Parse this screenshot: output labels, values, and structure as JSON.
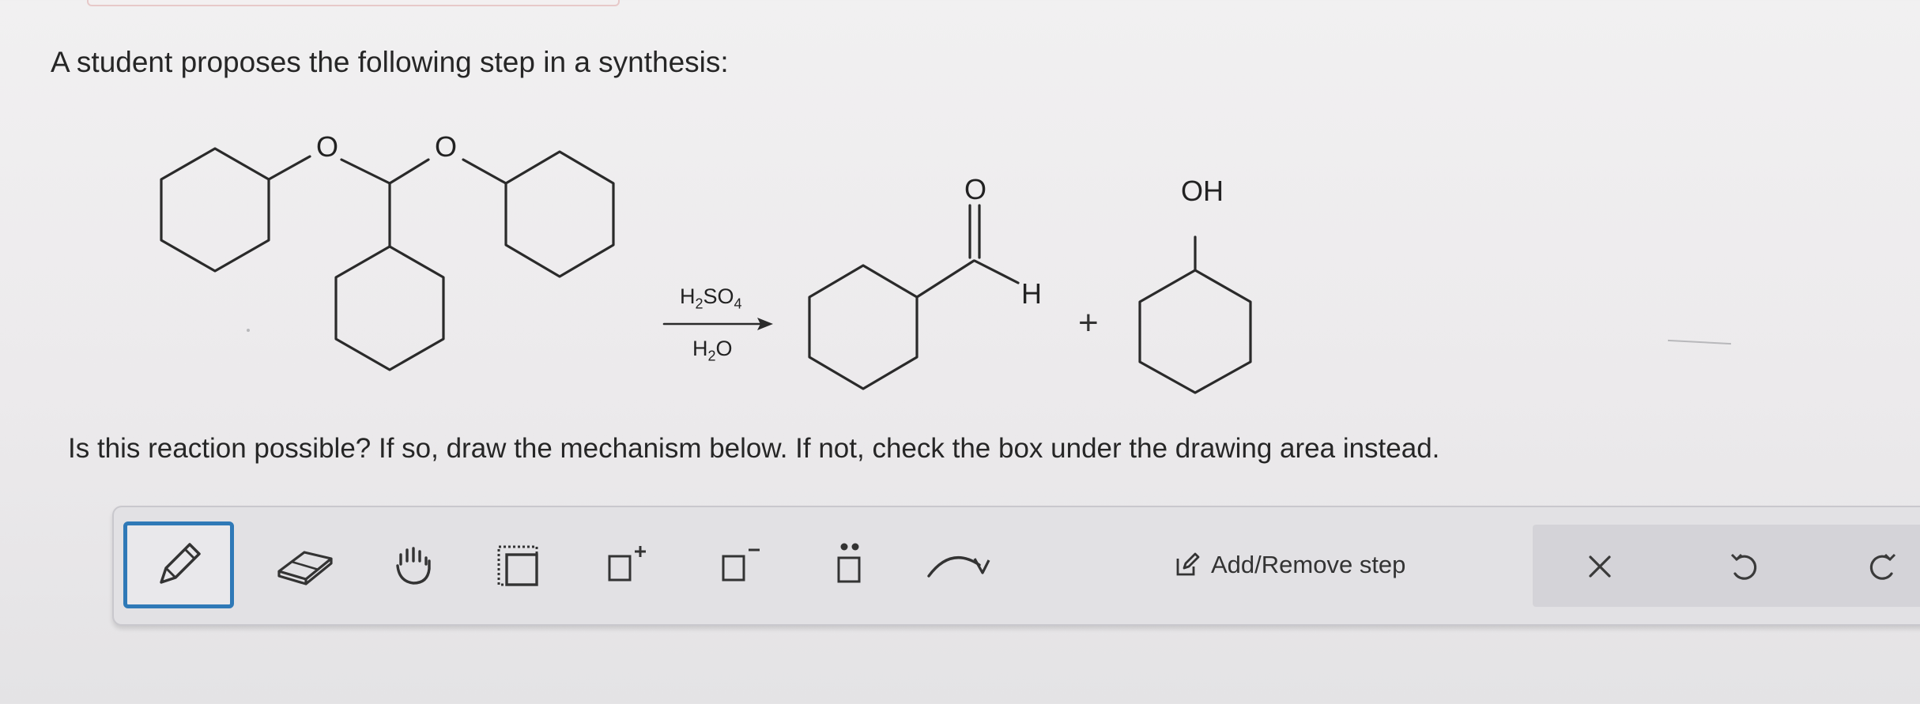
{
  "prompt": "A student proposes the following step in a synthesis:",
  "question": "Is this reaction possible? If so, draw the mechanism below. If not, check the box under the drawing area instead.",
  "reactant": {
    "atom_o1": "O",
    "atom_o2": "O"
  },
  "conditions": {
    "above": {
      "h": "H",
      "h_sub": "2",
      "so": "SO",
      "so_sub": "4"
    },
    "below": {
      "h": "H",
      "h_sub": "2",
      "o": "O"
    }
  },
  "products": {
    "aldehyde_o": "O",
    "aldehyde_h": "H",
    "plus": "+",
    "alcohol_oh": "OH"
  },
  "toolbar": {
    "tools": [
      {
        "name": "pencil",
        "icon": "pencil-icon",
        "selected": true
      },
      {
        "name": "eraser",
        "icon": "eraser-icon"
      },
      {
        "name": "hand",
        "icon": "hand-icon"
      },
      {
        "name": "select",
        "icon": "dotted-select-icon"
      },
      {
        "name": "positive-charge",
        "icon": "box-plus-icon",
        "label": "+"
      },
      {
        "name": "negative-charge",
        "icon": "box-minus-icon",
        "label": "−"
      },
      {
        "name": "lone-pair",
        "icon": "box-dots-icon"
      },
      {
        "name": "curved-arrow",
        "icon": "curved-arrow-icon"
      }
    ],
    "add_remove_step": "Add/Remove step",
    "right": {
      "clear": "×",
      "undo_icon": "undo-icon",
      "redo_icon": "redo-icon"
    },
    "colors": {
      "selected_border": "#2f79b7",
      "panel": "#d4d3d8"
    }
  }
}
